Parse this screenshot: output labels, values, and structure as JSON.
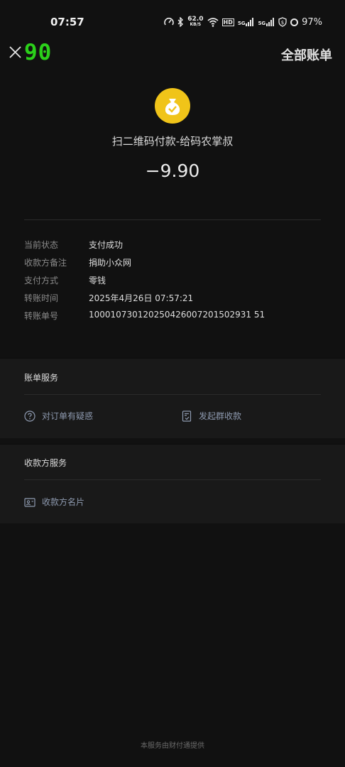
{
  "status_bar": {
    "time": "07:57",
    "net_speed_value": "62.0",
    "net_speed_unit": "KB/S",
    "hd_label": "HD",
    "sig1": "5G",
    "sig2": "5G",
    "battery": "97%"
  },
  "header": {
    "counter": "90",
    "all_bills": "全部账单"
  },
  "payment": {
    "merchant": "扫二维码付款-给码农掌叔",
    "amount": "−9.90"
  },
  "details": [
    {
      "label": "当前状态",
      "value": "支付成功"
    },
    {
      "label": "收款方备注",
      "value": "捐助小众网"
    },
    {
      "label": "支付方式",
      "value": "零钱"
    },
    {
      "label": "转账时间",
      "value": "2025年4月26日 07:57:21"
    },
    {
      "label": "转账单号",
      "value": "100010730120250426007201502931 51"
    }
  ],
  "bill_service": {
    "title": "账单服务",
    "question": "对订单有疑惑",
    "group_collect": "发起群收款"
  },
  "payee_service": {
    "title": "收款方服务",
    "payee_card": "收款方名片"
  },
  "footer": "本服务由财付通提供",
  "colors": {
    "accent_green": "#2bd11a",
    "coin_yellow": "#f0c419",
    "link_blue_gray": "#8e9ab0"
  }
}
